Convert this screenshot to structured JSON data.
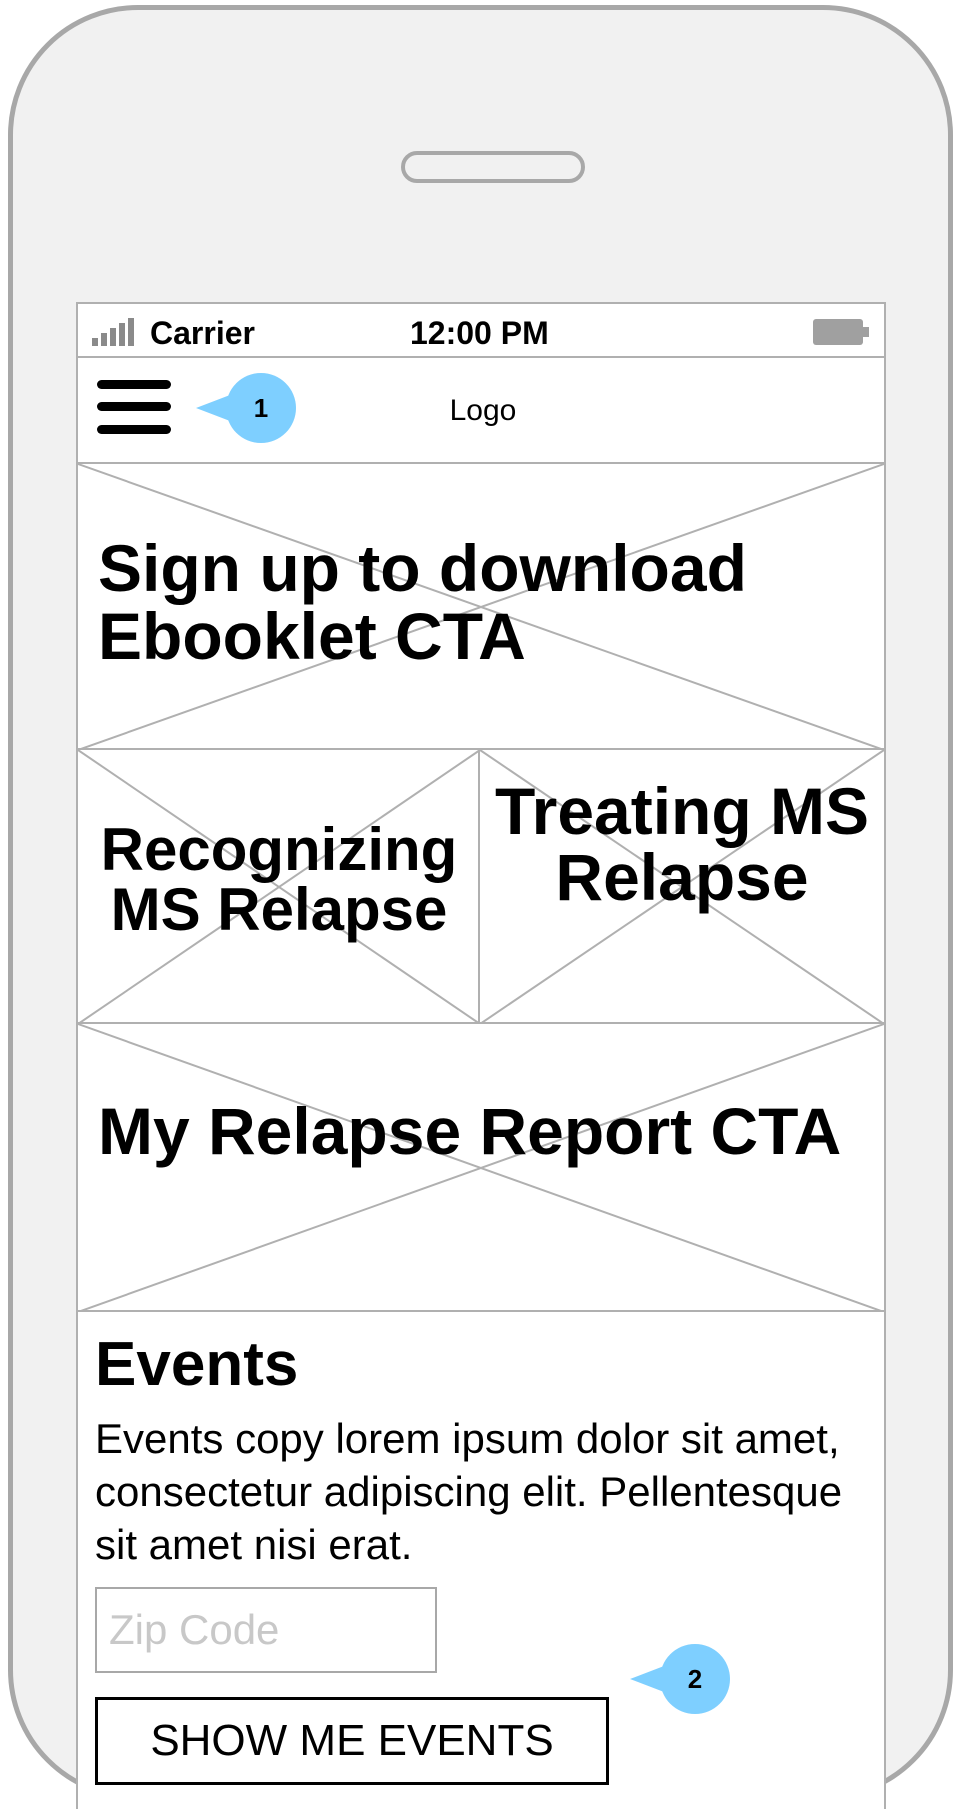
{
  "status_bar": {
    "carrier": "Carrier",
    "time": "12:00 PM",
    "signal_icon": "signal-bars-icon",
    "battery_icon": "battery-icon"
  },
  "nav": {
    "menu_icon": "hamburger-menu-icon",
    "logo": "Logo"
  },
  "annotations": [
    {
      "number": "1",
      "color": "#7ecfff"
    },
    {
      "number": "2",
      "color": "#7ecfff"
    }
  ],
  "tiles": {
    "ebooklet": "Sign up to download Ebooklet CTA",
    "recognizing": "Recognizing MS Relapse",
    "treating": "Treating MS Relapse",
    "report": "My Relapse Report CTA"
  },
  "events": {
    "title": "Events",
    "copy": "Events copy lorem ipsum dolor sit amet, consectetur adipiscing elit. Pellentesque sit amet nisi erat.",
    "zip_placeholder": "Zip Code",
    "button_label": "SHOW ME EVENTS"
  },
  "colors": {
    "phone_body": "#f1f1f1",
    "phone_border": "#a8a8a8",
    "callout": "#7ecfff"
  }
}
